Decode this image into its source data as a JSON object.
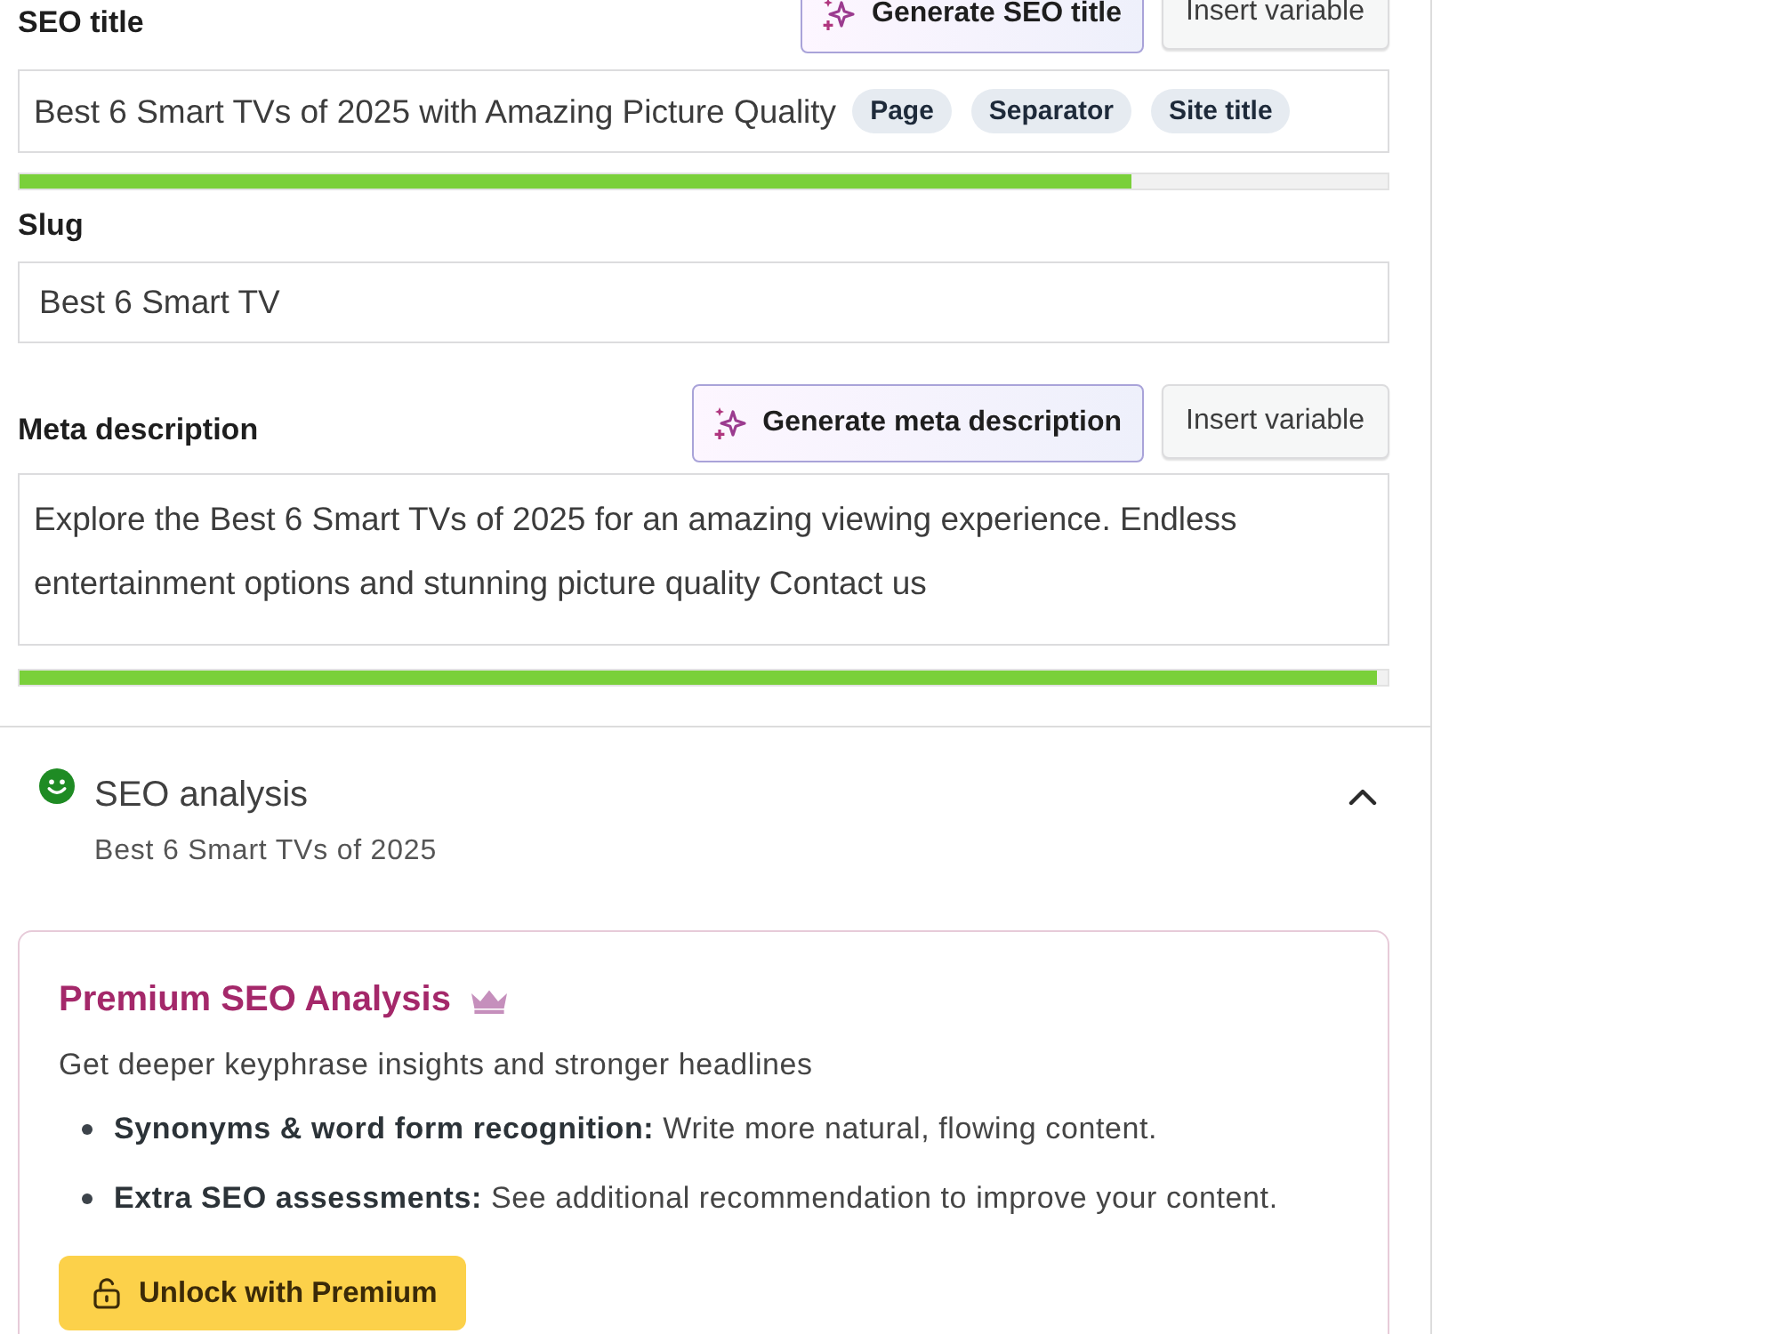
{
  "seo_title": {
    "label": "SEO title",
    "buttons": [
      {
        "kind": "ai",
        "label": "Generate SEO title"
      },
      {
        "kind": "plain",
        "label": "Insert variable"
      }
    ],
    "value": "Best 6 Smart TVs of 2025 with Amazing Picture Quality",
    "variables": [
      "Page",
      "Separator",
      "Site title"
    ],
    "level": 0.813
  },
  "slug": {
    "label": "Slug",
    "value": "Best 6 Smart TV"
  },
  "meta_description": {
    "label": "Meta description",
    "buttons": [
      {
        "kind": "ai",
        "label": "Generate meta description"
      },
      {
        "kind": "plain",
        "label": "Insert variable"
      }
    ],
    "value": "Explore the Best 6 Smart TVs of 2025 for an amazing viewing experience. Endless entertainment options and stunning picture quality Contact us",
    "level": 0.992
  },
  "seo_analysis": {
    "title": "SEO analysis",
    "subtitle": "Best 6 Smart TVs of 2025",
    "expanded": true
  },
  "premium": {
    "title": "Premium SEO Analysis",
    "description": "Get deeper keyphrase insights and stronger headlines",
    "features": [
      "**Synonyms & word form recognition:** Write more natural, flowing content.",
      "**Extra SEO assessments:** See additional recommendation to improve your content."
    ],
    "button": "Unlock with Premium"
  }
}
